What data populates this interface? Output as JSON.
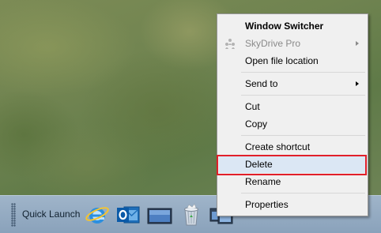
{
  "taskbar": {
    "quick_launch_label": "Quick Launch",
    "icons": [
      {
        "name": "internet-explorer-icon"
      },
      {
        "name": "outlook-icon"
      },
      {
        "name": "show-desktop-icon"
      },
      {
        "name": "recycle-bin-icon"
      },
      {
        "name": "window-switcher-icon"
      }
    ]
  },
  "context_menu": {
    "items": [
      {
        "label": "Window Switcher",
        "bold": true
      },
      {
        "label": "SkyDrive Pro",
        "disabled": true,
        "submenu": true,
        "icon": "skydrive-pro-icon"
      },
      {
        "label": "Open file location"
      },
      {
        "label": "Send to",
        "submenu": true
      },
      {
        "label": "Cut"
      },
      {
        "label": "Copy"
      },
      {
        "label": "Create shortcut"
      },
      {
        "label": "Delete",
        "highlighted": true
      },
      {
        "label": "Rename"
      },
      {
        "label": "Properties"
      }
    ]
  },
  "colors": {
    "highlight_box": "#e11f2a",
    "menu_background": "#f0f0f0",
    "menu_hover": "#dbe7f4",
    "taskbar": "#9fb4c9"
  }
}
